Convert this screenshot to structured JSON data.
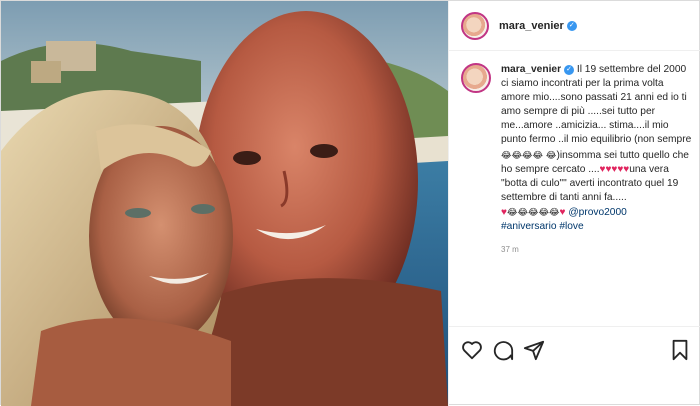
{
  "post": {
    "username": "mara_venier",
    "verified_mark": "✓",
    "caption_user": "mara_venier",
    "caption_text_1": " Il 19 settembre del 2000 ci siamo incontrati per la prima volta amore mio....sono passati 21 anni ed io ti amo sempre di più .....sei tutto per me...amore ..amicizia... stima....il mio punto fermo ..il mio equilibrio (non sempre ",
    "emoji_laugh_4": "😂😂😂😂",
    "emoji_laugh_1": "😂",
    "caption_text_2": ")insomma sei tutto quello che ho sempre cercato ....",
    "hearts_5": "♥♥♥♥♥",
    "caption_text_3": "una vera \"botta di culo\"\" averti incontrato quel 19 settembre di tanti anni fa.....",
    "hearts_1": "♥",
    "emoji_laugh_5": "😂😂😂😂😂",
    "heart_end": "♥",
    "mention": "@provo2000",
    "hashtags": "#aniversario #love",
    "time": "37 m"
  },
  "icons": {
    "like": "heart-icon",
    "comment": "comment-icon",
    "share": "share-icon",
    "save": "bookmark-icon"
  },
  "colors": {
    "link": "#00376b",
    "verified": "#3897f0",
    "heart": "#e0245e"
  }
}
